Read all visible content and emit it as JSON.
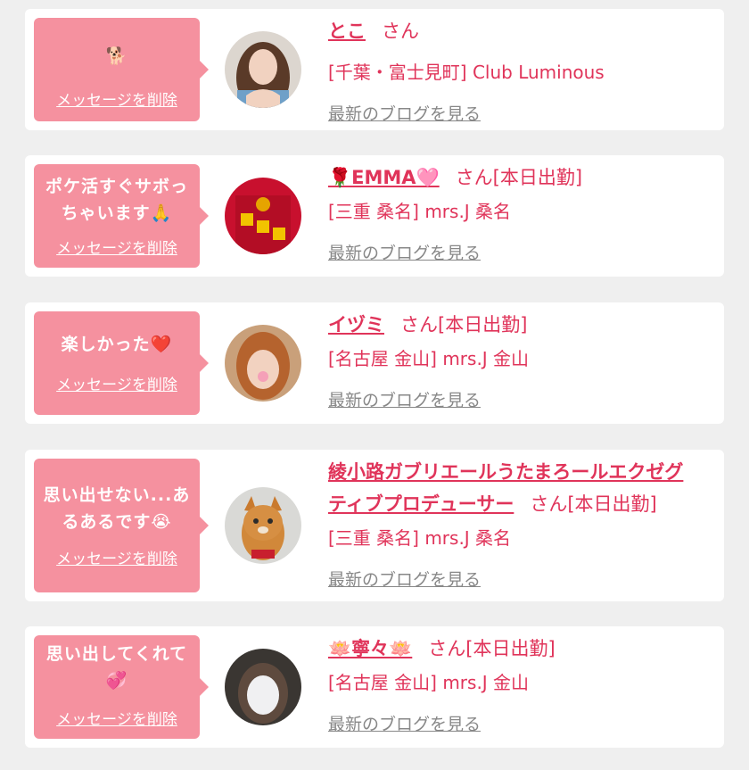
{
  "items": [
    {
      "message": "🐕",
      "delete_label": "メッセージを削除",
      "name": "とこ",
      "suffix": "さん",
      "shop": "[千葉・富士見町] Club Luminous",
      "blog_label": "最新のブログを見る"
    },
    {
      "message": "ポケ活すぐサボっ\nちゃいます🙏",
      "delete_label": "メッセージを削除",
      "name": "🌹EMMA🩷",
      "suffix": "さん[本日出勤]",
      "shop": "[三重 桑名] mrs.J 桑名",
      "blog_label": "最新のブログを見る"
    },
    {
      "message": "楽しかった❤️",
      "delete_label": "メッセージを削除",
      "name": "イヅミ",
      "suffix": "さん[本日出勤]",
      "shop": "[名古屋 金山] mrs.J 金山",
      "blog_label": "最新のブログを見る"
    },
    {
      "message": "思い出せない...あ\nるあるです😭",
      "delete_label": "メッセージを削除",
      "name_line1": "綾小路ガブリエールうたまろールエクゼグ",
      "name_line2": "ティブプロデューサー",
      "suffix": "さん[本日出勤]",
      "shop": "[三重 桑名] mrs.J 桑名",
      "blog_label": "最新のブログを見る"
    },
    {
      "message": "思い出してくれて\n💞",
      "delete_label": "メッセージを削除",
      "name": "🪷寧々🪷",
      "suffix": "さん[本日出勤]",
      "shop": "[名古屋 金山] mrs.J 金山",
      "blog_label": "最新のブログを見る"
    }
  ],
  "colors": {
    "page_bg": "#efefef",
    "bubble": "#f5919f",
    "accent_text": "#e0345a",
    "link_gray": "#888888"
  }
}
